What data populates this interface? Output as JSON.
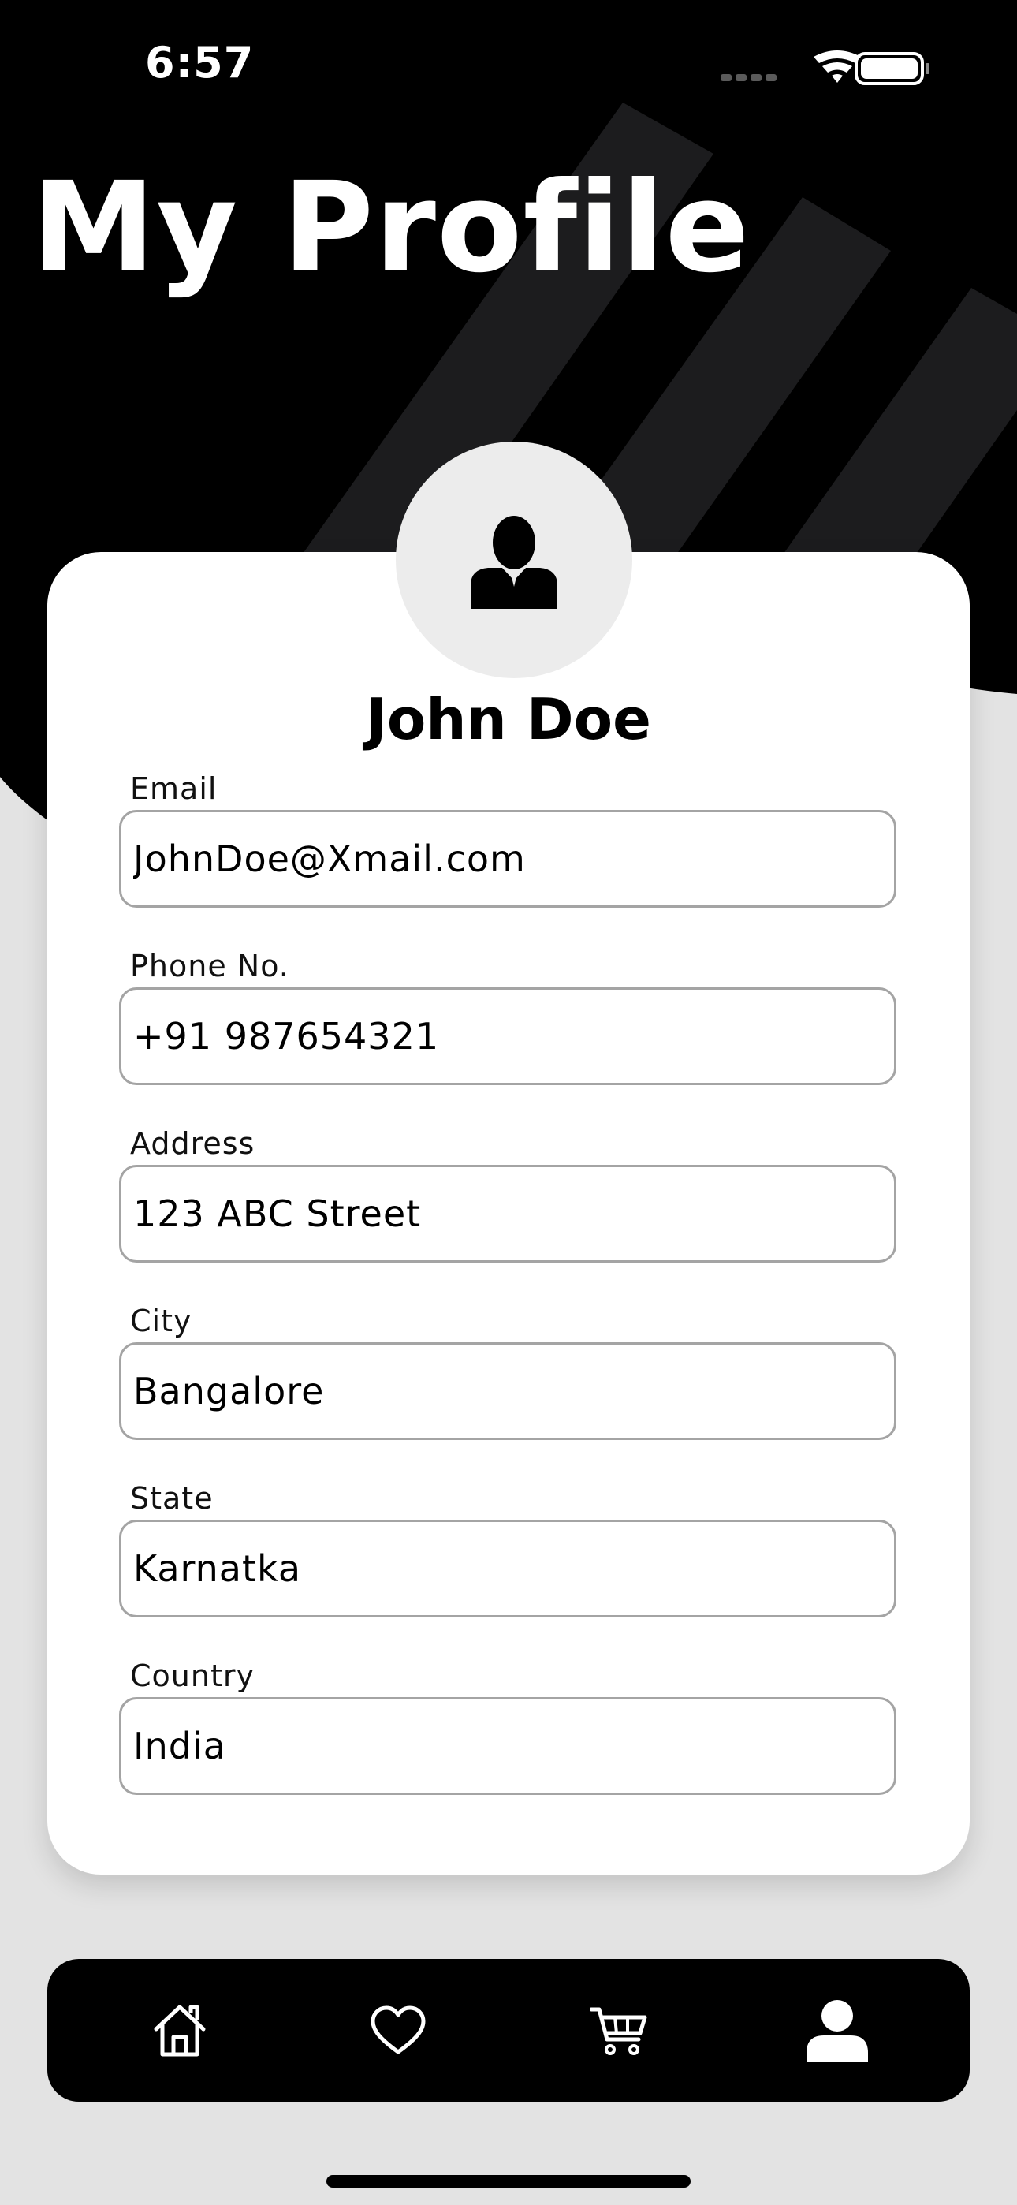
{
  "status_bar": {
    "time": "6:57"
  },
  "header": {
    "title": "My Profile"
  },
  "profile": {
    "name": "John Doe",
    "avatar_icon": "user-tie-icon",
    "fields": [
      {
        "label": "Email",
        "value": "JohnDoe@Xmail.com"
      },
      {
        "label": "Phone No.",
        "value": "+91 987654321"
      },
      {
        "label": "Address",
        "value": "123 ABC Street"
      },
      {
        "label": "City",
        "value": "Bangalore"
      },
      {
        "label": "State",
        "value": "Karnatka"
      },
      {
        "label": "Country",
        "value": "India"
      }
    ]
  },
  "bottom_nav": {
    "items": [
      {
        "icon": "home-icon",
        "active": false
      },
      {
        "icon": "heart-icon",
        "active": false
      },
      {
        "icon": "cart-icon",
        "active": false
      },
      {
        "icon": "profile-icon",
        "active": true
      }
    ]
  },
  "colors": {
    "header_background": "#000000",
    "page_background": "#e3e3e3",
    "stripe": "#1c1c1e",
    "card": "#ffffff",
    "avatar_background": "#ececec",
    "input_border": "#a4a4a4",
    "nav_background": "#000000",
    "nav_icon": "#ffffff"
  }
}
